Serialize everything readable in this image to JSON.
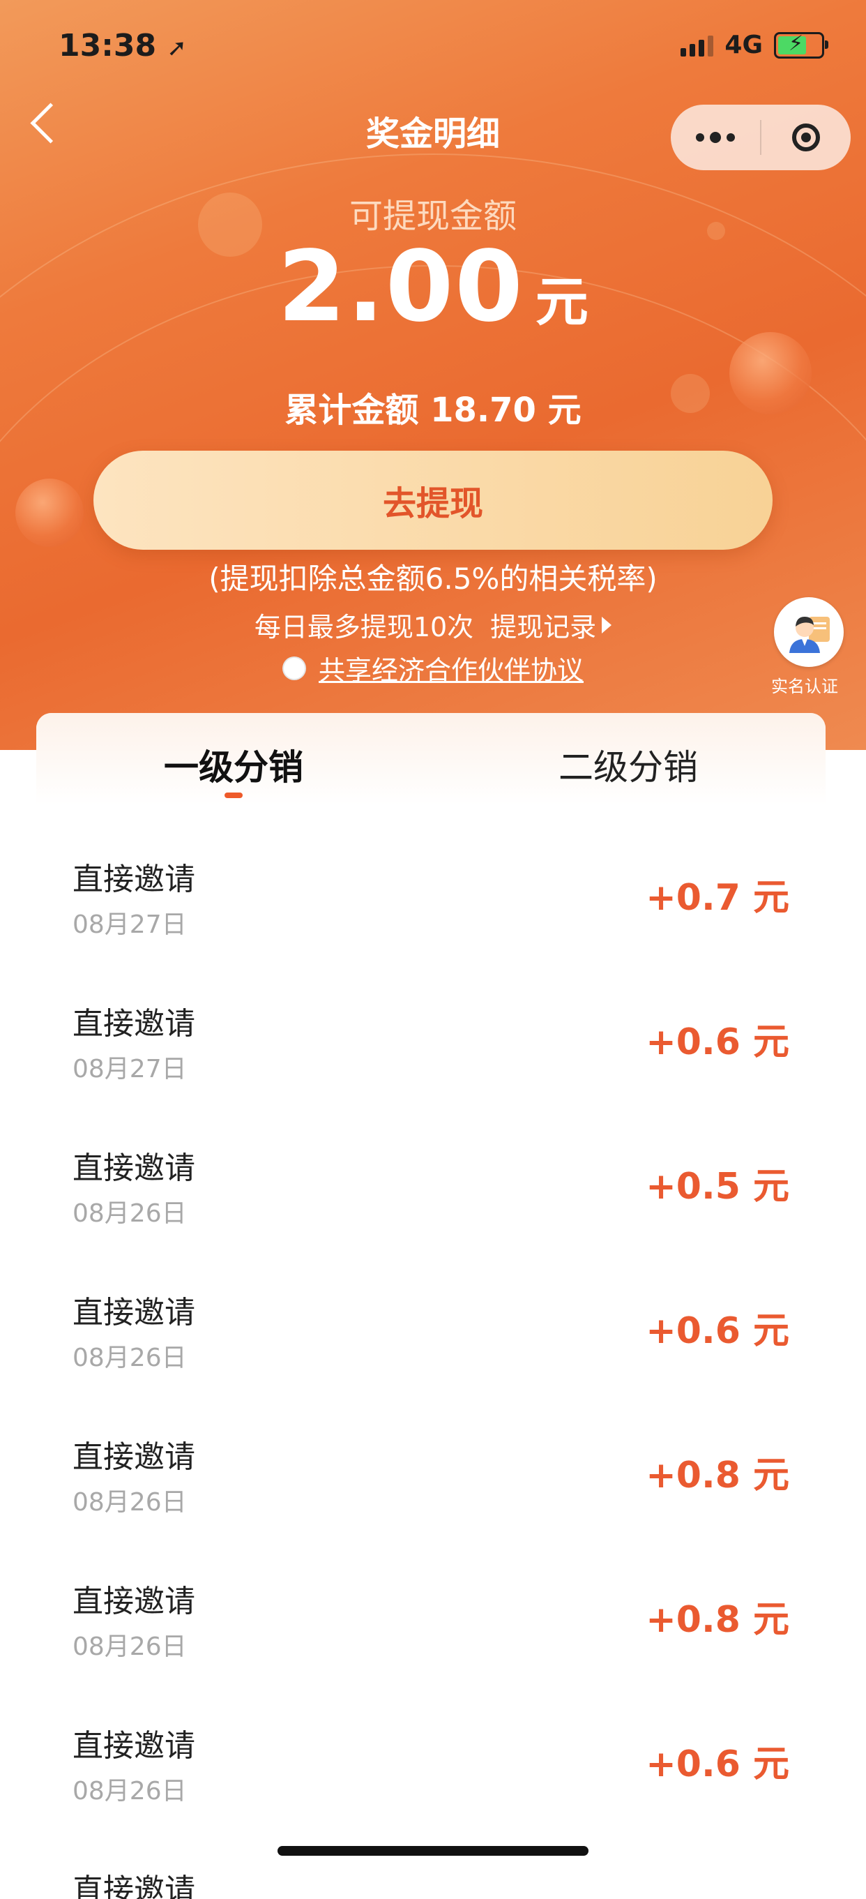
{
  "status_bar": {
    "time": "13:38",
    "network": "4G"
  },
  "nav": {
    "title": "奖金明细"
  },
  "balance": {
    "available_label": "可提现金额",
    "amount": "2.00",
    "unit": "元",
    "total_text": "累计金额 18.70 元"
  },
  "withdraw": {
    "button_label": "去提现",
    "tax_note": "(提现扣除总金额6.5%的相关税率)",
    "daily_limit": "每日最多提现10次",
    "records_link": "提现记录",
    "agreement_text": "共享经济合作伙伴协议"
  },
  "realname": {
    "label": "实名认证"
  },
  "tabs": [
    {
      "label": "一级分销"
    },
    {
      "label": "二级分销"
    }
  ],
  "records": [
    {
      "title": "直接邀请",
      "date": "08月27日",
      "amount": "+0.7 元"
    },
    {
      "title": "直接邀请",
      "date": "08月27日",
      "amount": "+0.6 元"
    },
    {
      "title": "直接邀请",
      "date": "08月26日",
      "amount": "+0.5 元"
    },
    {
      "title": "直接邀请",
      "date": "08月26日",
      "amount": "+0.6 元"
    },
    {
      "title": "直接邀请",
      "date": "08月26日",
      "amount": "+0.8 元"
    },
    {
      "title": "直接邀请",
      "date": "08月26日",
      "amount": "+0.8 元"
    },
    {
      "title": "直接邀请",
      "date": "08月26日",
      "amount": "+0.6 元"
    },
    {
      "title": "直接邀请",
      "date": "",
      "amount": ""
    }
  ],
  "colors": {
    "accent": "#ea5a30",
    "hero": "#ee7a3c",
    "button": "#fde4c0"
  }
}
